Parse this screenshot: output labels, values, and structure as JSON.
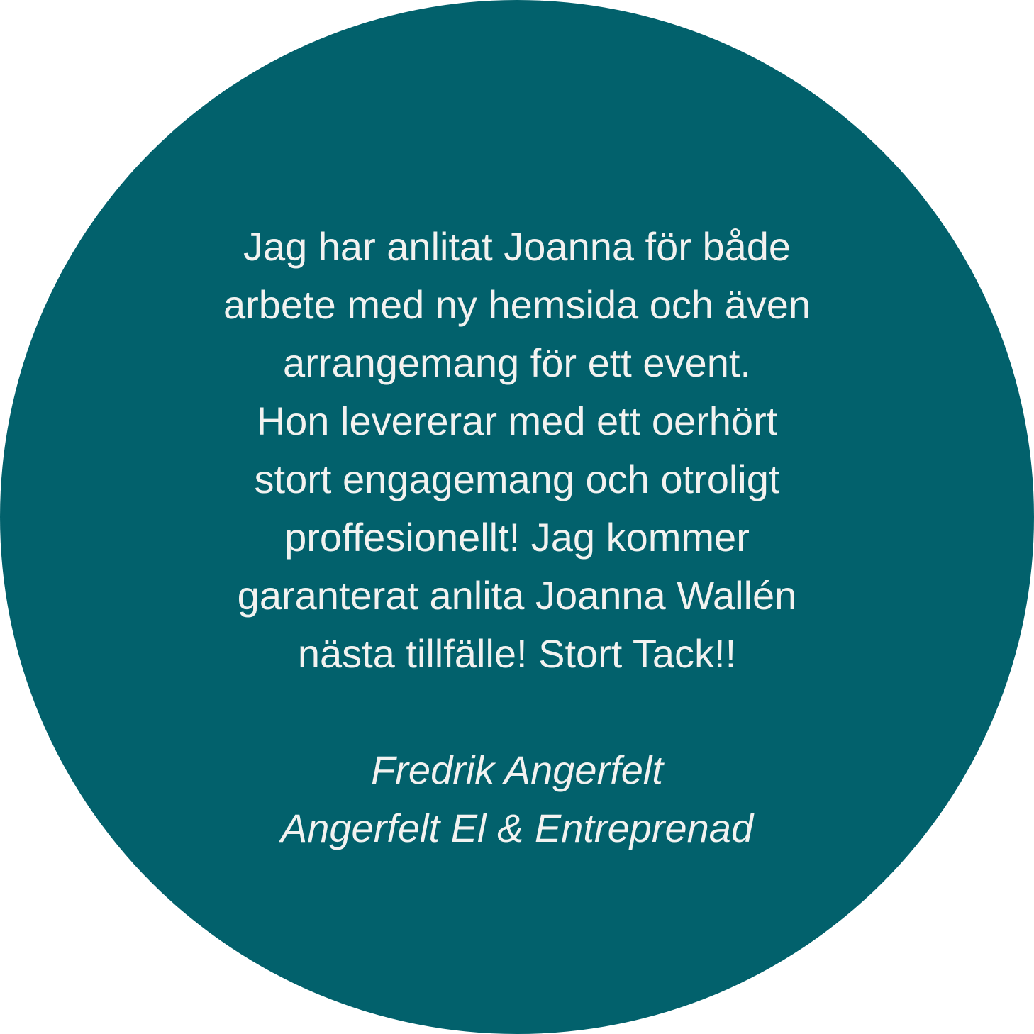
{
  "colors": {
    "circle": "#02616c",
    "text": "#f2f2f0",
    "background": "#ffffff"
  },
  "quote": {
    "lines": [
      "Jag har anlitat Joanna för både",
      "arbete med ny hemsida och även",
      "arrangemang för ett event.",
      "Hon levererar med ett oerhört",
      "stort engagemang och otroligt",
      "proffesionellt! Jag kommer",
      "garanterat anlita Joanna Wallén",
      "nästa tillfälle! Stort Tack!!"
    ]
  },
  "attribution": {
    "name": "Fredrik Angerfelt",
    "company": "Angerfelt El & Entreprenad"
  }
}
